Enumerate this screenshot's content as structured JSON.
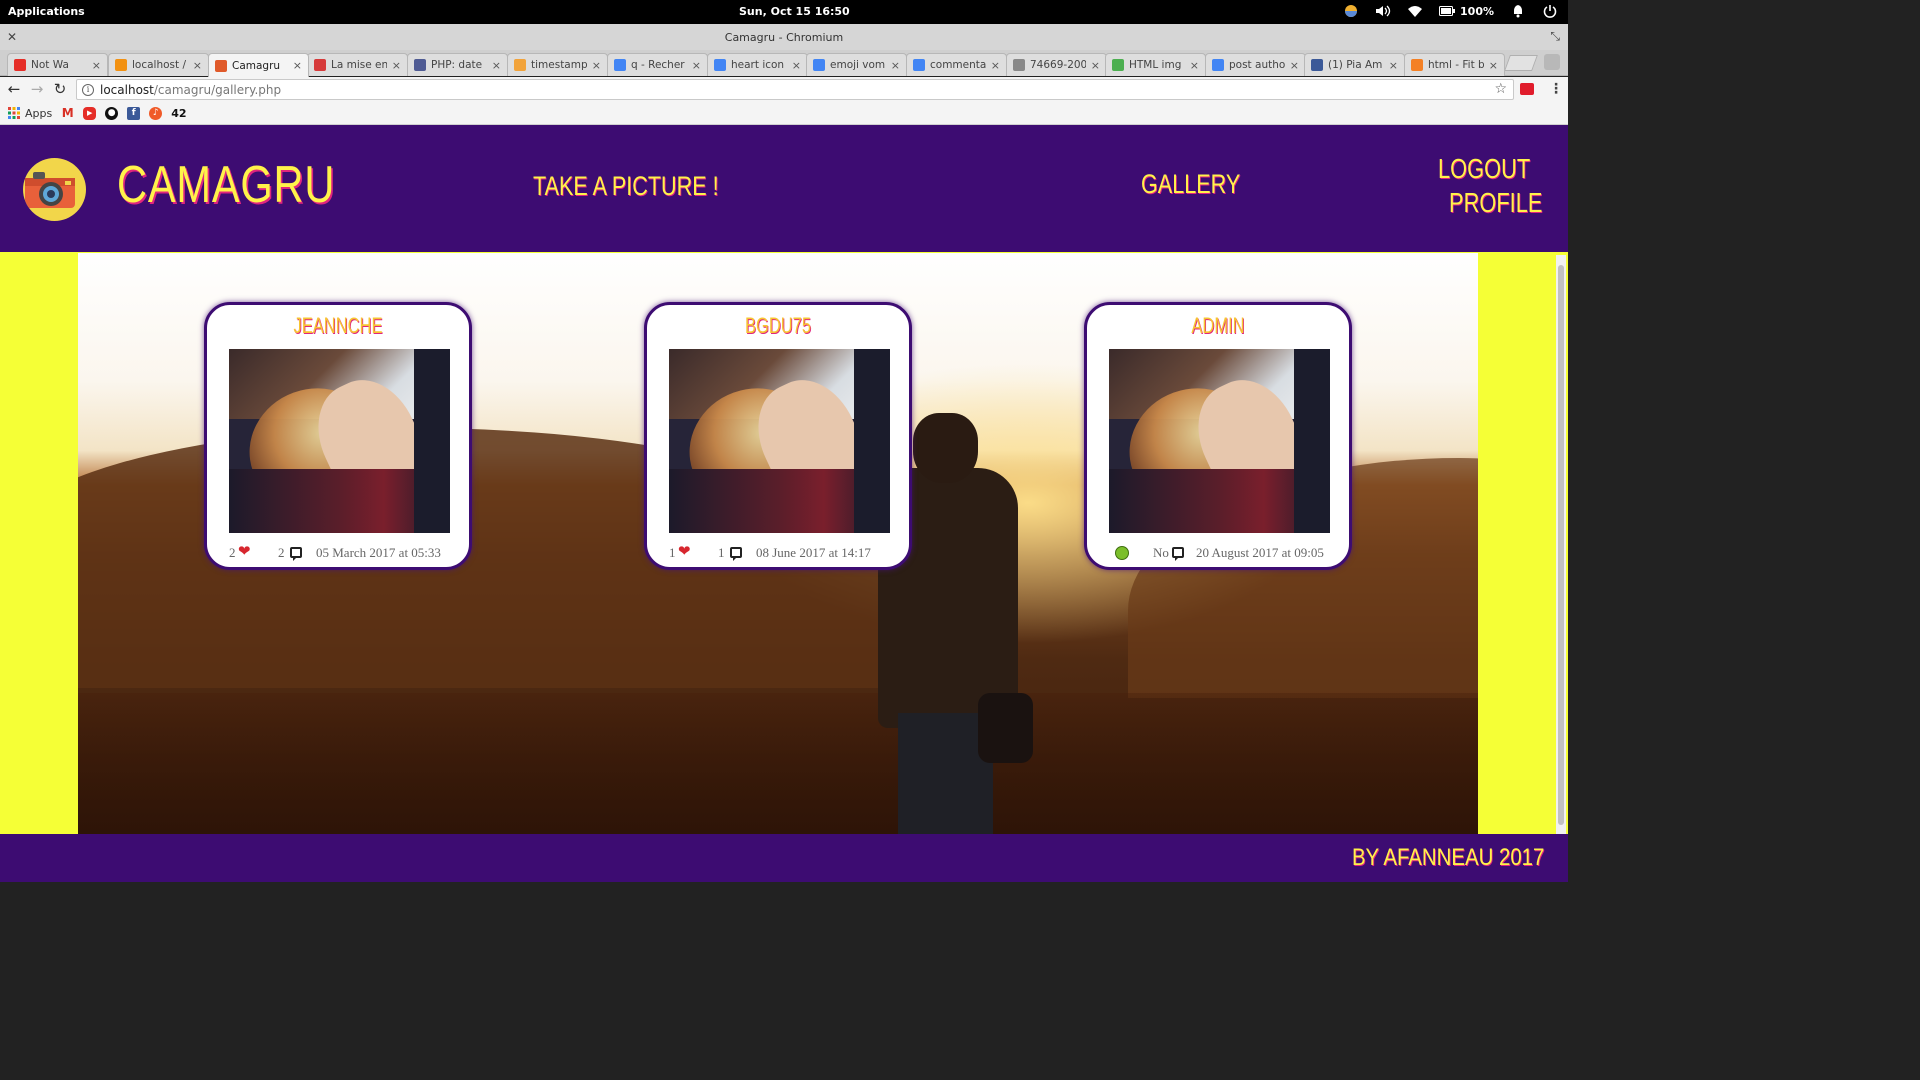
{
  "system_bar": {
    "apps_label": "Applications",
    "clock": "Sun, Oct 15   16:50",
    "battery": "100%"
  },
  "window": {
    "title": "Camagru - Chromium"
  },
  "tabs": [
    {
      "label": "Not Wa",
      "favicon_color": "#e52d27"
    },
    {
      "label": "localhost /",
      "favicon_color": "#f29111"
    },
    {
      "label": "Camagru",
      "favicon_color": "#e05a2a",
      "active": true
    },
    {
      "label": "La mise en",
      "favicon_color": "#d63a3a"
    },
    {
      "label": "PHP: date",
      "favicon_color": "#4f5b93"
    },
    {
      "label": "timestamp",
      "favicon_color": "#f2a33a"
    },
    {
      "label": "q - Recher",
      "favicon_color": "#4285f4"
    },
    {
      "label": "heart icon",
      "favicon_color": "#4285f4"
    },
    {
      "label": "emoji vom",
      "favicon_color": "#4285f4"
    },
    {
      "label": "commenta",
      "favicon_color": "#4285f4"
    },
    {
      "label": "74669-200",
      "favicon_color": "#888888"
    },
    {
      "label": "HTML img",
      "favicon_color": "#4caf50"
    },
    {
      "label": "post autho",
      "favicon_color": "#4285f4"
    },
    {
      "label": "(1) Pia Am",
      "favicon_color": "#3b5998"
    },
    {
      "label": "html - Fit b",
      "favicon_color": "#f48024"
    }
  ],
  "address_bar": {
    "host": "localhost",
    "path": "/camagru/gallery.php"
  },
  "bookmarks": {
    "apps_label": "Apps",
    "fortytwo_label": "42"
  },
  "site": {
    "brand": "CAMAGRU",
    "nav": {
      "take_picture": "TAKE A PICTURE !",
      "gallery": "GALLERY",
      "logout": "LOGOUT",
      "profile": "PROFILE"
    },
    "footer_credit": "BY AFANNEAU 2017"
  },
  "gallery": {
    "cards": [
      {
        "author": "JEANNCHE",
        "likes": "2",
        "comments": "2",
        "date": "05 March 2017 at 05:33",
        "liked": true
      },
      {
        "author": "BGDU75",
        "likes": "1",
        "comments": "1",
        "date": "08 June 2017 at 14:17",
        "liked": true
      },
      {
        "author": "ADMIN",
        "likes": "",
        "comments": "No",
        "date": "20 August 2017 at 09:05",
        "liked": false
      }
    ]
  },
  "colors": {
    "header_purple": "#3d0c72",
    "accent_yellow": "#fff34a",
    "side_yellow": "#f5ff36",
    "heart_red": "#d7262e"
  }
}
